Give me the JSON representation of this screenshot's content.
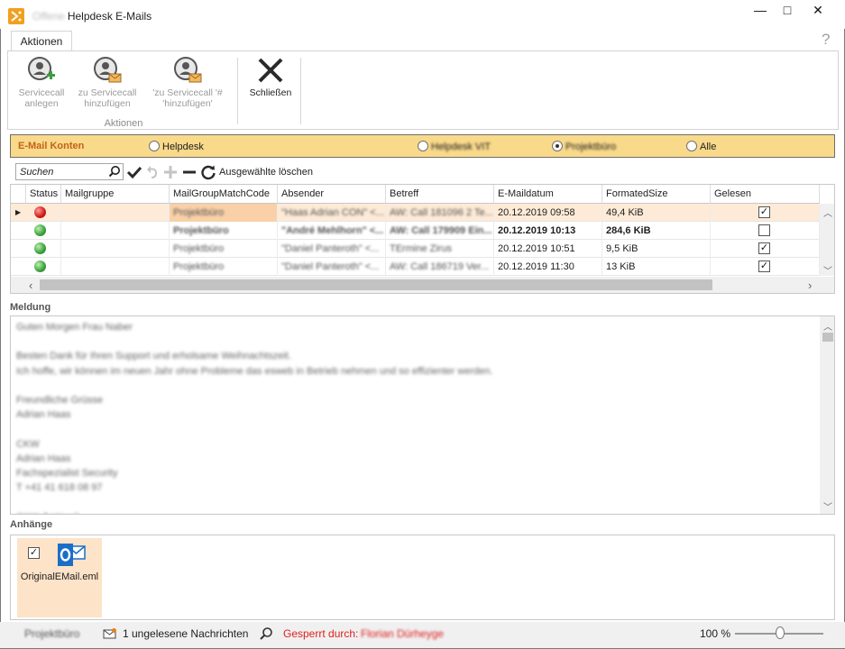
{
  "window": {
    "title_prefix": "Offene",
    "title": "Helpdesk E-Mails",
    "controls": {
      "minimize": "—",
      "maximize": "□",
      "close": "✕"
    }
  },
  "ribbon": {
    "tab": "Aktionen",
    "help": "?",
    "group_label": "Aktionen",
    "buttons": [
      {
        "label_line1": "Servicecall",
        "label_line2": "anlegen",
        "icon": "servicecall-add-icon",
        "enabled": false
      },
      {
        "label_line1": "zu Servicecall",
        "label_line2": "hinzufügen",
        "icon": "servicecall-mail-icon",
        "enabled": false
      },
      {
        "label_line1": "'zu Servicecall '#",
        "label_line2": "'hinzufügen'",
        "icon": "servicecall-mail-icon",
        "enabled": false
      },
      {
        "label_line1": "Schließen",
        "label_line2": "",
        "icon": "close-x-icon",
        "enabled": true
      }
    ]
  },
  "konten": {
    "label": "E-Mail Konten",
    "options": [
      {
        "label": "Helpdesk",
        "selected": false,
        "blurred": false
      },
      {
        "label": "Helpdesk VIT",
        "selected": false,
        "blurred": true
      },
      {
        "label": "Projektbüro",
        "selected": true,
        "blurred": true
      },
      {
        "label": "Alle",
        "selected": false,
        "blurred": false
      }
    ]
  },
  "toolbar": {
    "search_placeholder": "Suchen",
    "delete_label": "Ausgewählte löschen"
  },
  "grid": {
    "columns": [
      "Status",
      "Mailgruppe",
      "MailGroupMatchCode",
      "Absender",
      "Betreff",
      "E-Maildatum",
      "FormatedSize",
      "Gelesen"
    ],
    "rows": [
      {
        "status": "red",
        "mailgruppe": "",
        "matchcode": "Projektbüro",
        "absender": "\"Haas Adrian CON\" <...",
        "betreff": "AW: Call 181096 2 Te...",
        "datum": "20.12.2019 09:58",
        "size": "49,4 KiB",
        "gelesen": true,
        "bold": false,
        "selected": true
      },
      {
        "status": "green",
        "mailgruppe": "",
        "matchcode": "Projektbüro",
        "absender": "\"André Mehlhorn\" <...",
        "betreff": "AW: Call 179909 Ein...",
        "datum": "20.12.2019 10:13",
        "size": "284,6 KiB",
        "gelesen": false,
        "bold": true,
        "selected": false
      },
      {
        "status": "green",
        "mailgruppe": "",
        "matchcode": "Projektbüro",
        "absender": "\"Daniel Panteroth\" <...",
        "betreff": "TErmine Zirus",
        "datum": "20.12.2019 10:51",
        "size": "9,5 KiB",
        "gelesen": true,
        "bold": false,
        "selected": false
      },
      {
        "status": "green",
        "mailgruppe": "",
        "matchcode": "Projektbüro",
        "absender": "\"Daniel Panteroth\" <...",
        "betreff": "AW: Call 186719 Ver...",
        "datum": "20.12.2019 11:30",
        "size": "13 KiB",
        "gelesen": true,
        "bold": false,
        "selected": false
      }
    ]
  },
  "meldung": {
    "label": "Meldung",
    "text": "Guten Morgen Frau Naber\n\nBesten Dank für Ihren Support und erholsame Weihnachtszeit.\nIch hoffe, wir können im neuen Jahr ohne Probleme das esweb in Betrieb nehmen und so effizienter werden.\n\nFreundliche Grüsse\nAdrian Haas\n\nCKW\nAdrian Haas\nFachspezialist Security\nT +41 41 618 08 97\n\nCKW Z Hügeli"
  },
  "anhaenge": {
    "label": "Anhänge",
    "file_name": "OriginalEMail.eml",
    "checked": true
  },
  "statusbar": {
    "account": "Projektbüro",
    "unread": "1 ungelesene Nachrichten",
    "locked_label": "Gesperrt durch:",
    "locked_user": "Florian Dürheyge",
    "zoom": "100 %",
    "zoom_level": 0.5
  },
  "colors": {
    "accent_bar": "#f9d98a",
    "selected_row": "#fdebd7",
    "locked_red": "#e02020"
  }
}
